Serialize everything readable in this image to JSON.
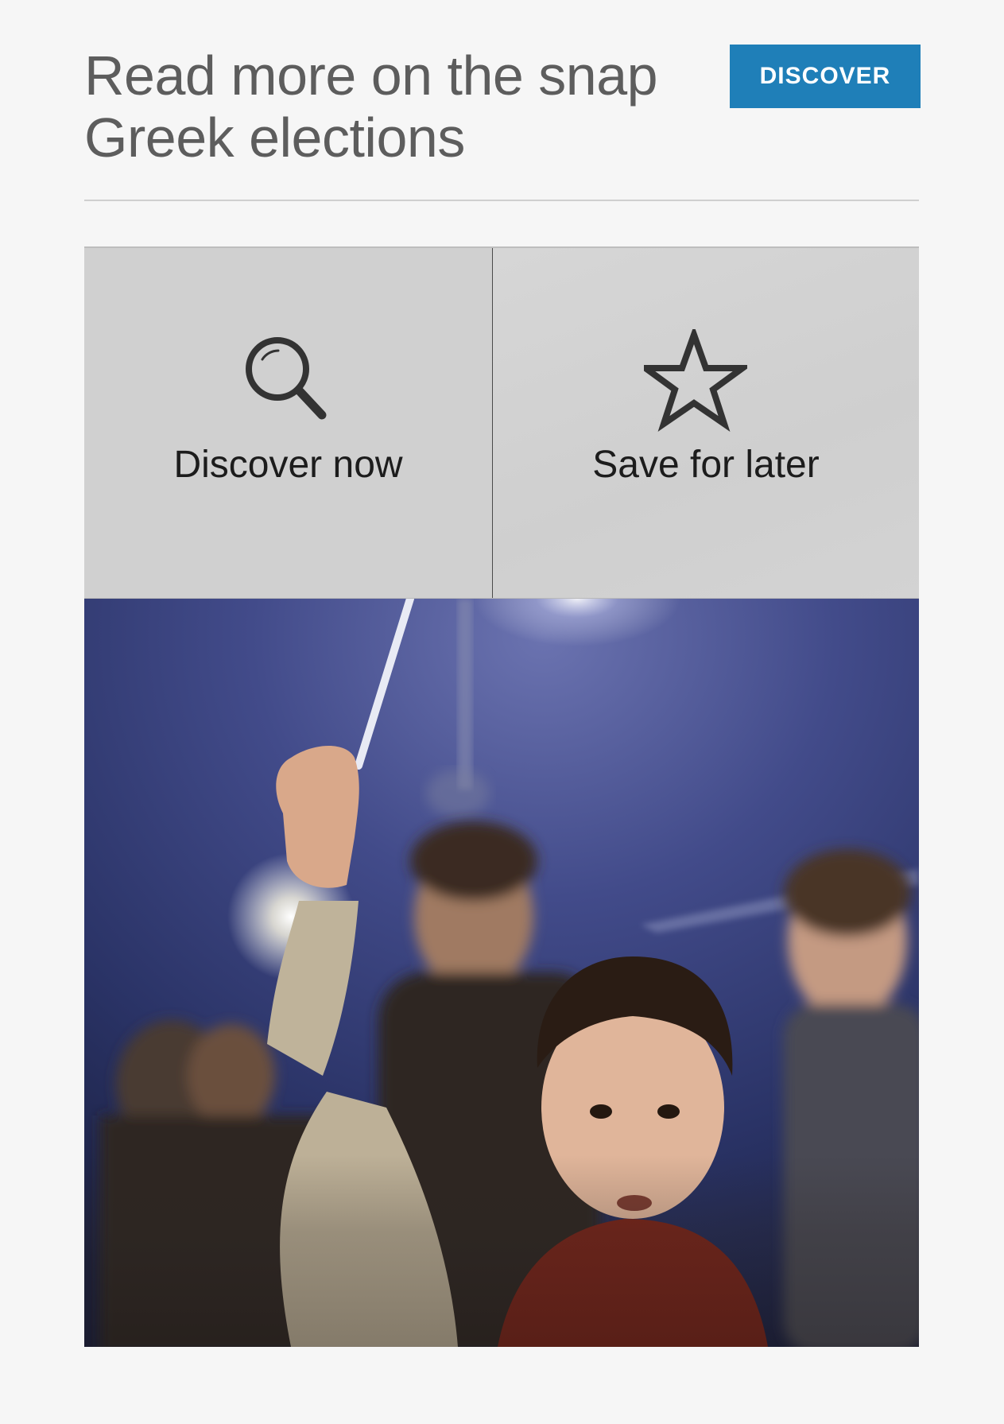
{
  "header": {
    "headline": "Read more on the snap Greek elections",
    "discover_button": "DISCOVER"
  },
  "actions": [
    {
      "label": "Discover now",
      "icon": "search-icon"
    },
    {
      "label": "Save for later",
      "icon": "star-icon"
    }
  ],
  "photo": {
    "subject": "crowd-photo"
  },
  "colors": {
    "accent": "#1f7fb8",
    "headline": "#5d5d5d",
    "background": "#f6f6f6"
  }
}
